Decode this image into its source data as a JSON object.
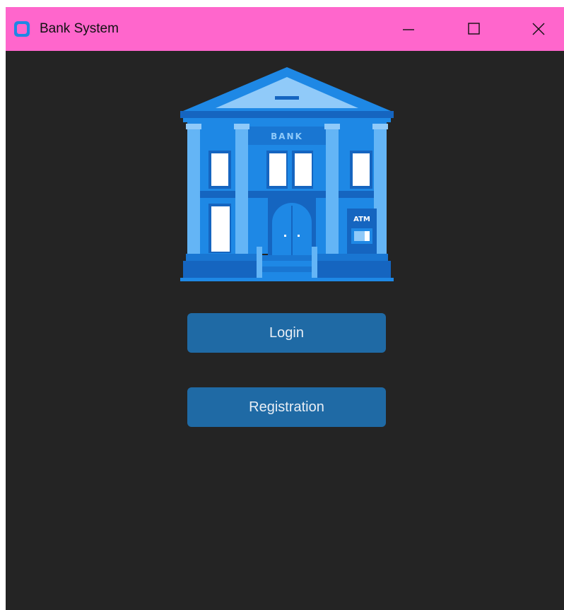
{
  "window": {
    "title": "Bank System",
    "app_icon": "app-logo-icon",
    "controls": {
      "minimize_icon": "minimize-icon",
      "maximize_icon": "maximize-icon",
      "close_icon": "close-icon"
    }
  },
  "illustration": {
    "sign_text": "BANK",
    "atm_text": "ATM",
    "icon": "bank-building-illustration"
  },
  "actions": {
    "login_label": "Login",
    "registration_label": "Registration"
  },
  "colors": {
    "titlebar": "#ff66cc",
    "background": "#242424",
    "button": "#1f6aa5",
    "button_text": "#e8eef5"
  }
}
